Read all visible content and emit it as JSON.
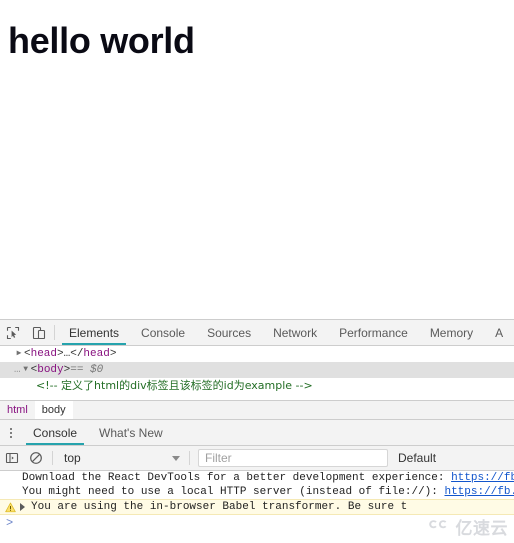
{
  "page": {
    "heading": "hello world"
  },
  "devtools": {
    "toolbar_icons": [
      {
        "name": "inspect-element-icon",
        "title": "Inspect element"
      },
      {
        "name": "device-toolbar-icon",
        "title": "Toggle device toolbar"
      }
    ],
    "tabs": [
      {
        "label": "Elements",
        "active": true
      },
      {
        "label": "Console",
        "active": false
      },
      {
        "label": "Sources",
        "active": false
      },
      {
        "label": "Network",
        "active": false
      },
      {
        "label": "Performance",
        "active": false
      },
      {
        "label": "Memory",
        "active": false
      },
      {
        "label": "A",
        "active": false
      }
    ],
    "elements_tree": [
      {
        "triangle": "▶",
        "indent": 1,
        "selected": false,
        "prefix": "",
        "parts": [
          {
            "type": "punct",
            "text": "<"
          },
          {
            "type": "tag",
            "text": "head"
          },
          {
            "type": "punct",
            "text": ">…</"
          },
          {
            "type": "tag",
            "text": "head"
          },
          {
            "type": "punct",
            "text": ">"
          }
        ]
      },
      {
        "triangle": "▼",
        "indent": 1,
        "selected": true,
        "prefix": "…",
        "parts": [
          {
            "type": "punct",
            "text": "<"
          },
          {
            "type": "tag",
            "text": "body"
          },
          {
            "type": "punct",
            "text": ">"
          },
          {
            "type": "dollar0",
            "text": "  ==  $0"
          }
        ]
      },
      {
        "triangle": "",
        "indent": 2,
        "selected": false,
        "prefix": "",
        "parts": [
          {
            "type": "comment",
            "text": "<!-- 定义了html的div标签且该标签的id为example -->"
          }
        ]
      }
    ],
    "breadcrumb": [
      {
        "label": "html",
        "selected": false
      },
      {
        "label": "body",
        "selected": true
      }
    ],
    "drawer": {
      "kebab_icon": "more-options-icon",
      "tabs": [
        {
          "label": "Console",
          "active": true
        },
        {
          "label": "What's New",
          "active": false
        }
      ],
      "console_toolbar": {
        "sidebar_toggle_icon": "console-sidebar-icon",
        "clear_icon": "clear-console-icon",
        "context": "top",
        "filter_placeholder": "Filter",
        "levels": "Default"
      },
      "messages": [
        {
          "kind": "info",
          "segments": [
            {
              "type": "text",
              "text": "Download the React DevTools for a better development experience: "
            },
            {
              "type": "link",
              "text": "https://fb"
            }
          ]
        },
        {
          "kind": "info",
          "segments": [
            {
              "type": "text",
              "text": "You might need to use a local HTTP server (instead of file://): "
            },
            {
              "type": "link",
              "text": "https://fb."
            }
          ]
        },
        {
          "kind": "warning",
          "expandable": true,
          "segments": [
            {
              "type": "text",
              "text": "You are using the in-browser Babel transformer. Be sure t"
            }
          ]
        }
      ],
      "prompt": ">"
    }
  },
  "watermark": {
    "logo_icon": "cloud-logo-icon",
    "text": "亿速云"
  }
}
